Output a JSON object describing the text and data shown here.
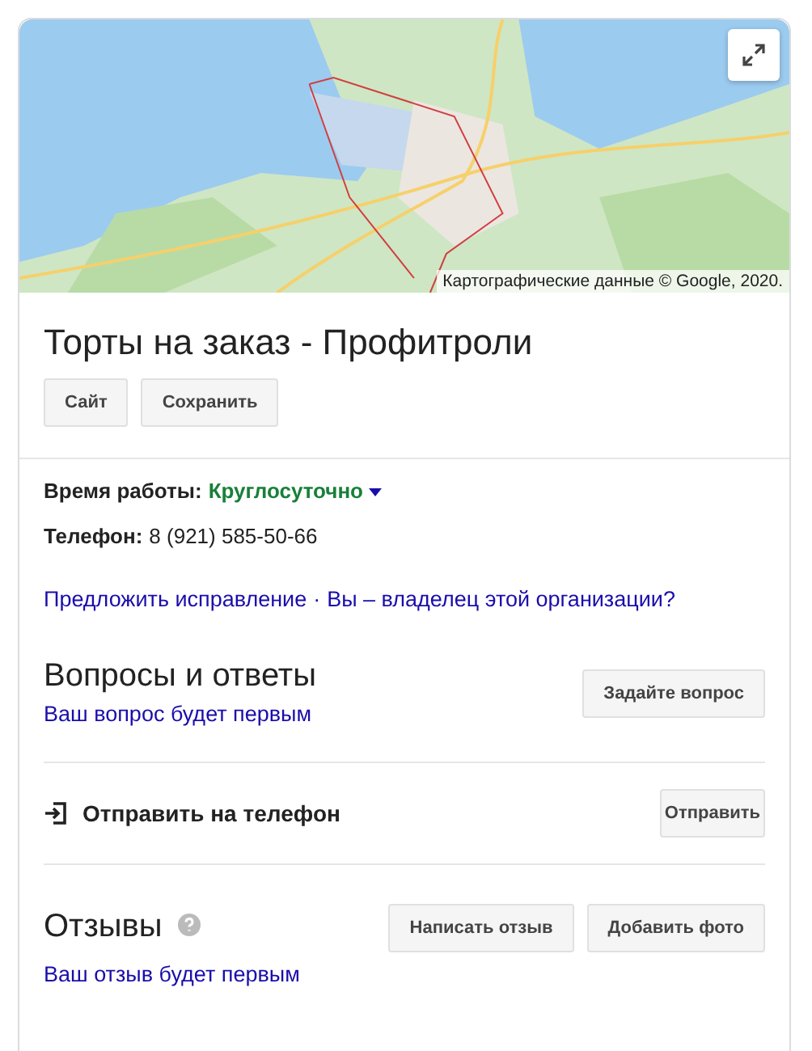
{
  "map": {
    "attribution": "Картографические данные © Google, 2020."
  },
  "title": "Торты на заказ - Профитроли",
  "actions": [
    "Сайт",
    "Сохранить"
  ],
  "hours": {
    "label": "Время работы:",
    "value": "Круглосуточно"
  },
  "phone": {
    "label": "Телефон:",
    "value": "8 (921) 585-50-66"
  },
  "edit_links": {
    "suggest": "Предложить исправление",
    "separator": "·",
    "owner": "Вы – владелец этой организации?"
  },
  "questions": {
    "title": "Вопросы и ответы",
    "subtitle": "Ваш вопрос будет первым",
    "button": "Задайте вопрос"
  },
  "send_to_phone": {
    "label": "Отправить на телефон",
    "button": "Отправить"
  },
  "reviews": {
    "title": "Отзывы",
    "subtitle": "Ваш отзыв будет первым",
    "buttons": [
      "Написать отзыв",
      "Добавить фото"
    ]
  }
}
